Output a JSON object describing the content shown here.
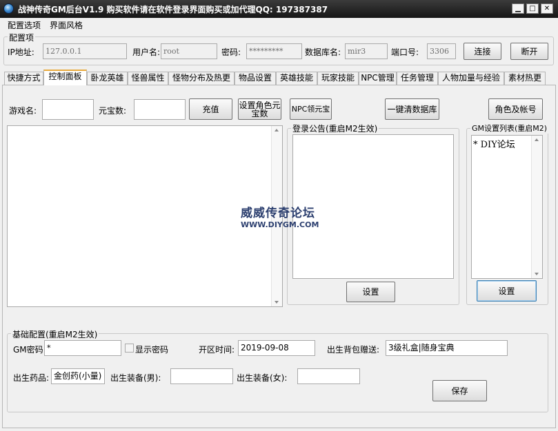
{
  "window": {
    "title": "战神传奇GM后台V1.9    购买软件请在软件登录界面购买或加代理QQ:  197387387",
    "controls": {
      "minimize": "▁",
      "maximize": "□",
      "close": "✕"
    }
  },
  "menubar": [
    "配置选项",
    "界面风格"
  ],
  "config": {
    "group_title": "配置项",
    "ip_label": "IP地址:",
    "ip_value": "127.0.0.1",
    "user_label": "用户名:",
    "user_value": "root",
    "password_label": "密码:",
    "password_value": "*********",
    "db_label": "数据库名:",
    "db_value": "mir3",
    "port_label": "端口号:",
    "port_value": "3306",
    "connect_btn": "连接",
    "disconnect_btn": "断开"
  },
  "tabs": [
    "快捷方式",
    "控制面板",
    "卧龙英雄",
    "怪兽属性",
    "怪物分布及热更",
    "物品设置",
    "英雄技能",
    "玩家技能",
    "NPC管理",
    "任务管理",
    "人物加量与经验",
    "素材热更"
  ],
  "active_tab": "控制面板",
  "panel": {
    "game_name_label": "游戏名:",
    "game_name_value": "",
    "yuanbao_label": "元宝数:",
    "yuanbao_value": "",
    "recharge_btn": "充值",
    "set_role_yuanbao_btn_line1": "设置角色元",
    "set_role_yuanbao_btn_line2": "宝数",
    "npc_yuanbao_btn": "NPC领元宝",
    "clear_db_btn": "一键清数据库",
    "role_account_btn": "角色及帐号",
    "login_notice_title": "登录公告(重启M2生效)",
    "login_notice_set_btn": "设置",
    "gm_list_title": "GM设置列表(重启M2)",
    "gm_list_items": [
      "* DIY论坛"
    ],
    "gm_list_set_btn": "设置"
  },
  "watermark": {
    "cn": "威威传奇论坛",
    "en": "WWW.DIYGM.COM"
  },
  "basic": {
    "group_title": "基础配置(重启M2生效)",
    "gm_password_label": "GM密码:",
    "gm_password_value": "*",
    "show_password_label": "显示密码",
    "open_time_label": "开区时间:",
    "open_time_value": "2019-09-08",
    "bag_gift_label": "出生背包赠送:",
    "bag_gift_value": "3级礼盒|随身宝典",
    "medicine_label": "出生药品:",
    "medicine_value": "金创药(小量)",
    "equip_male_label": "出生装备(男):",
    "equip_male_value": "",
    "equip_female_label": "出生装备(女):",
    "equip_female_value": "",
    "save_btn": "保存"
  }
}
